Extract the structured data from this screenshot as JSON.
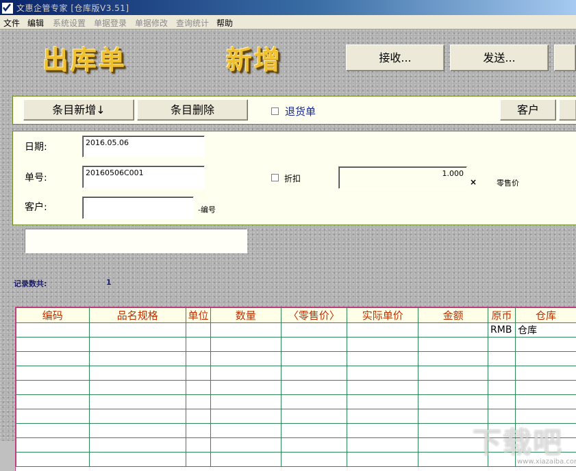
{
  "window": {
    "title": "文惠企管专家 [仓库版V3.51]"
  },
  "menu": [
    "文件",
    "编辑",
    "系统设置",
    "单据登录",
    "单据修改",
    "查询统计",
    "帮助"
  ],
  "header": {
    "doc_type": "出库单",
    "mode": "新增",
    "receive_button": "接收...",
    "send_button": "发送..."
  },
  "toolbar": {
    "add_item_button": "条目新增↓",
    "delete_item_button": "条目删除",
    "return_label": "退货单",
    "customer_button": "客户"
  },
  "form": {
    "date_label": "日期:",
    "date_value": "2016.05.06",
    "number_label": "单号:",
    "number_value": "20160506C001",
    "customer_label": "客户:",
    "customer_value": "",
    "code_suffix": "-编号",
    "discount_label": "折扣",
    "discount_value": "1.000",
    "multiply_sign": "×",
    "retail_price_label": "零售价"
  },
  "records": {
    "label": "记录数共:",
    "count": "1"
  },
  "grid": {
    "columns": [
      "编码",
      "品名规格",
      "单位",
      "数量",
      "〈零售价〉",
      "实际单价",
      "金额",
      "原币",
      "仓库"
    ],
    "rows": [
      [
        "",
        "",
        "",
        "",
        "",
        "",
        "",
        "RMB",
        "仓库"
      ],
      [
        "",
        "",
        "",
        "",
        "",
        "",
        "",
        "",
        ""
      ],
      [
        "",
        "",
        "",
        "",
        "",
        "",
        "",
        "",
        ""
      ],
      [
        "",
        "",
        "",
        "",
        "",
        "",
        "",
        "",
        ""
      ],
      [
        "",
        "",
        "",
        "",
        "",
        "",
        "",
        "",
        ""
      ],
      [
        "",
        "",
        "",
        "",
        "",
        "",
        "",
        "",
        ""
      ],
      [
        "",
        "",
        "",
        "",
        "",
        "",
        "",
        "",
        ""
      ],
      [
        "",
        "",
        "",
        "",
        "",
        "",
        "",
        "",
        ""
      ],
      [
        "",
        "",
        "",
        "",
        "",
        "",
        "",
        "",
        ""
      ],
      [
        "",
        "",
        "",
        "",
        "",
        "",
        "",
        "",
        ""
      ]
    ]
  },
  "watermark": {
    "text": "下载吧",
    "url": "www.xiazaiba.com"
  },
  "colors": {
    "title_gold": "#f0c030",
    "grid_line": "#2e8b57",
    "header_text": "#c03000",
    "panel_bg": "#fffff0"
  }
}
